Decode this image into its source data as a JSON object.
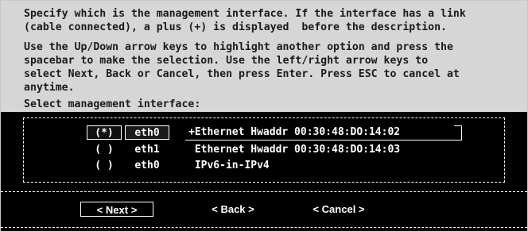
{
  "intro_lines": [
    "Specify which is the management interface. If the interface has a link",
    "(cable connected), a plus (+) is displayed  before the description."
  ],
  "instruction_lines": [
    "Use the Up/Down arrow keys to highlight another option and press the",
    "spacebar to make the selection. Use the left/right arrow keys to",
    "select Next, Back or Cancel, then press Enter. Press ESC to cancel at",
    "anytime."
  ],
  "prompt": "Select management interface:",
  "options": [
    {
      "mark": "(*)",
      "iface": "eth0",
      "desc": "+Ethernet Hwaddr 00:30:48:DO:14:02"
    },
    {
      "mark": "( )",
      "iface": "eth1",
      "desc": " Ethernet Hwaddr 00:30:48:DO:14:03"
    },
    {
      "mark": "( )",
      "iface": "eth0",
      "desc": " IPv6-in-IPv4"
    }
  ],
  "buttons": {
    "next": "< Next >",
    "back": "< Back >",
    "cancel": "< Cancel >"
  }
}
